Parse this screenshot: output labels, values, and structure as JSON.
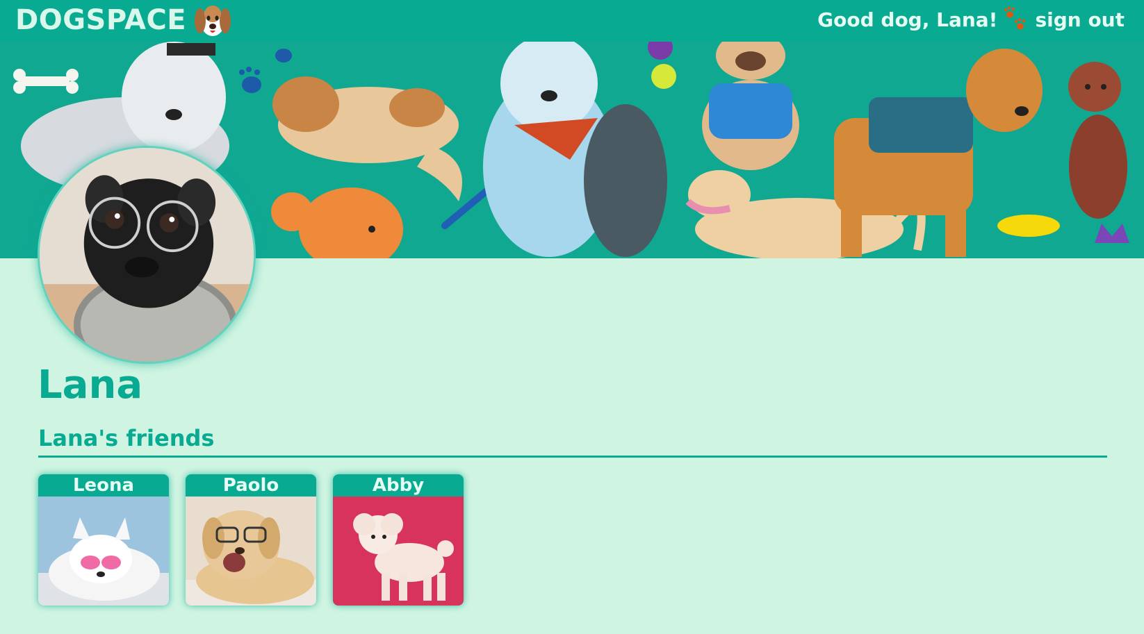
{
  "header": {
    "logo_text": "DOGSPACE",
    "logo_icon": "dog-face-icon",
    "greeting": "Good dog, Lana!",
    "paws_icon": "paw-prints-icon",
    "signout_label": "sign out"
  },
  "colors": {
    "brand": "#08ab92",
    "background": "#cff4e2",
    "header_text": "#e6fbf1"
  },
  "profile": {
    "name": "Lana",
    "avatar_icon": "pug-with-glasses-avatar"
  },
  "friends": {
    "heading": "Lana's friends",
    "items": [
      {
        "name": "Leona"
      },
      {
        "name": "Paolo"
      },
      {
        "name": "Abby"
      }
    ]
  }
}
